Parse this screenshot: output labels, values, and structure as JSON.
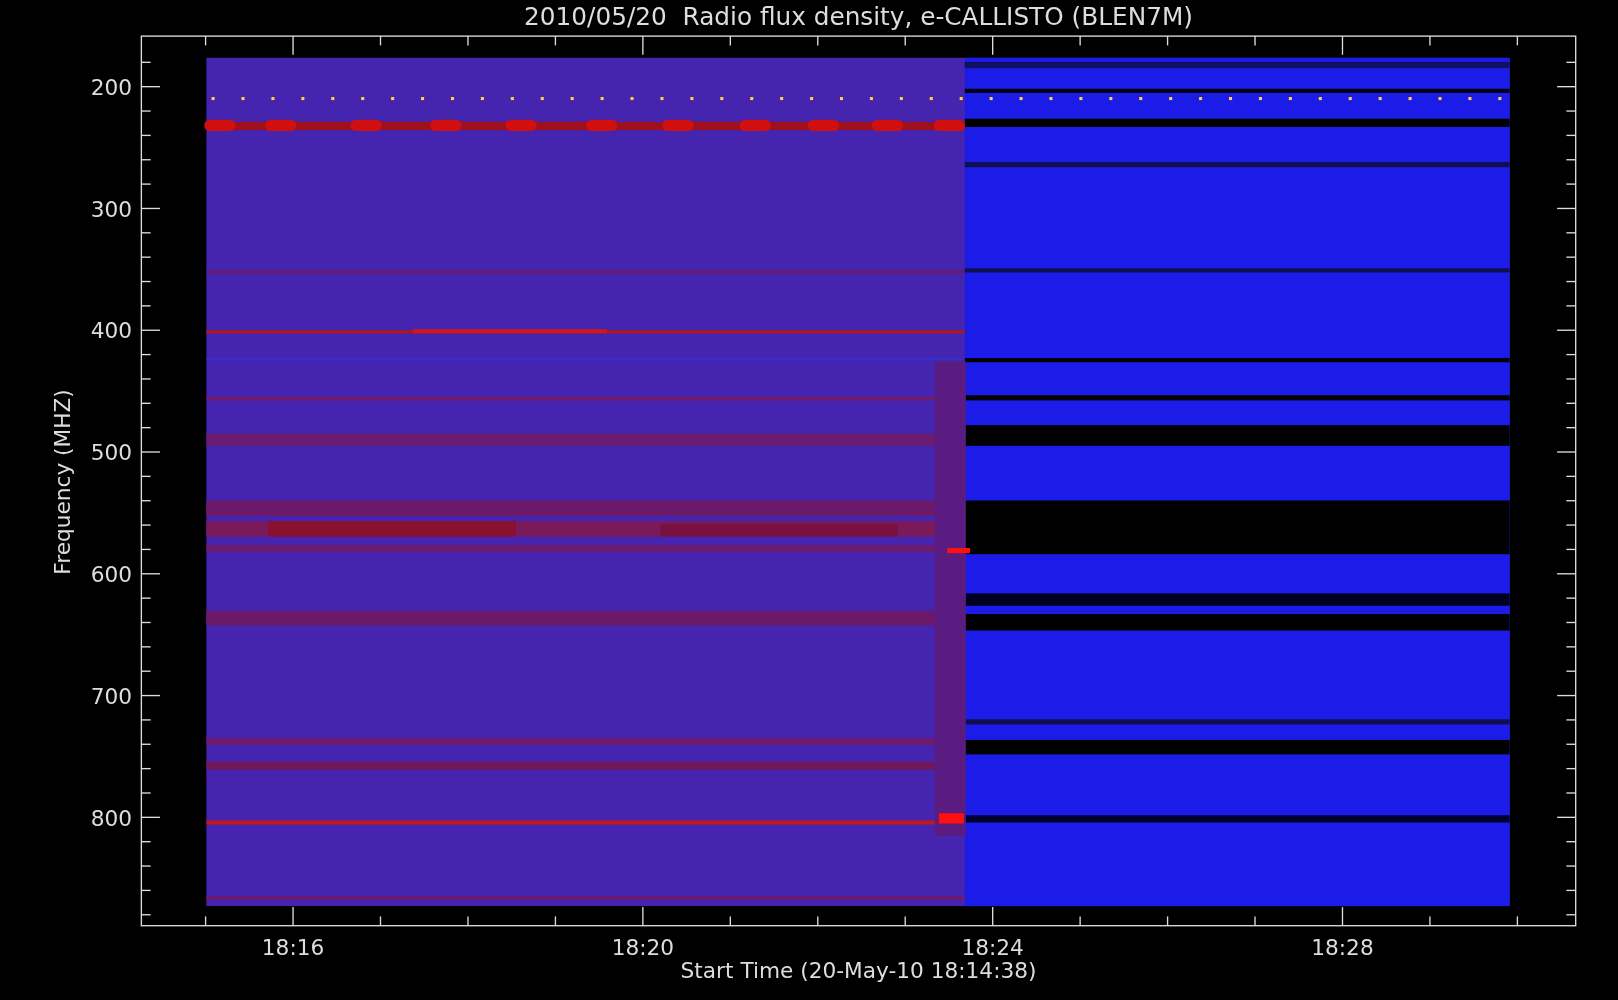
{
  "title": "2010/05/20  Radio flux density, e-CALLISTO (BLEN7M)",
  "ylabel": "Frequency (MHZ)",
  "yticks": [
    "200",
    "300",
    "400",
    "500",
    "600",
    "700",
    "800"
  ],
  "xticks": [
    "18:16",
    "18:20",
    "18:24",
    "18:28"
  ],
  "xlabel": "Start Time (20-May-10 18:14:38)"
}
